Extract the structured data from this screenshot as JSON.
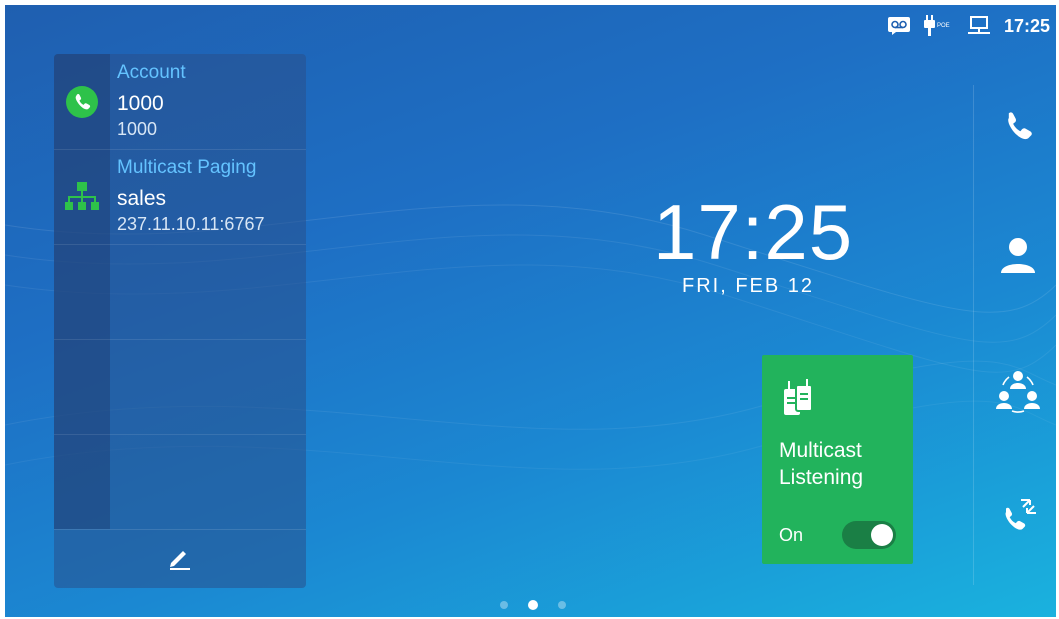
{
  "status_bar": {
    "time": "17:25",
    "icons": [
      "voicemail-icon",
      "poe-plug-icon",
      "network-icon"
    ],
    "poe_label": "POE"
  },
  "accounts_panel": {
    "items": [
      {
        "title": "Account",
        "name": "1000",
        "sub": "1000",
        "icon": "phone-icon"
      },
      {
        "title": "Multicast Paging",
        "name": "sales",
        "sub": "237.11.10.11:6767",
        "icon": "network-tree-icon"
      }
    ],
    "edit_icon": "pencil-icon"
  },
  "clock": {
    "time": "17:25",
    "date": "FRI, FEB 12"
  },
  "multicast_widget": {
    "title": "Multicast Listening",
    "state_label": "On",
    "toggle_on": true,
    "color": "#22b35c"
  },
  "dock": {
    "buttons": [
      "phone-icon",
      "contacts-icon",
      "conference-icon",
      "call-history-icon"
    ]
  },
  "page_indicator": {
    "count": 3,
    "active_index": 1
  }
}
